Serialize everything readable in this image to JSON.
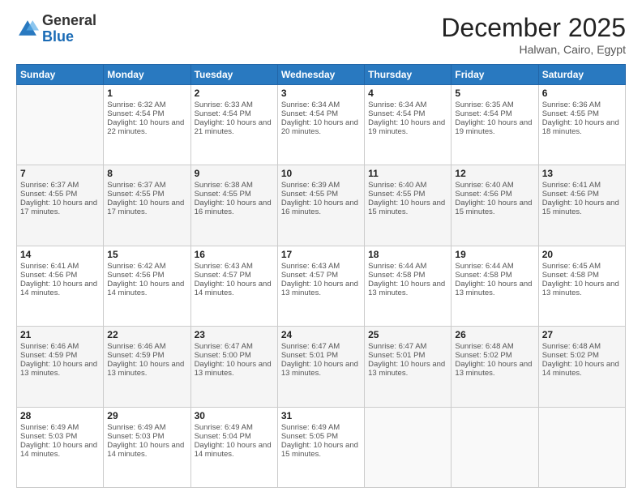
{
  "logo": {
    "general": "General",
    "blue": "Blue"
  },
  "header": {
    "month": "December 2025",
    "location": "Halwan, Cairo, Egypt"
  },
  "days_of_week": [
    "Sunday",
    "Monday",
    "Tuesday",
    "Wednesday",
    "Thursday",
    "Friday",
    "Saturday"
  ],
  "weeks": [
    [
      {
        "day": "",
        "sunrise": "",
        "sunset": "",
        "daylight": ""
      },
      {
        "day": "1",
        "sunrise": "Sunrise: 6:32 AM",
        "sunset": "Sunset: 4:54 PM",
        "daylight": "Daylight: 10 hours and 22 minutes."
      },
      {
        "day": "2",
        "sunrise": "Sunrise: 6:33 AM",
        "sunset": "Sunset: 4:54 PM",
        "daylight": "Daylight: 10 hours and 21 minutes."
      },
      {
        "day": "3",
        "sunrise": "Sunrise: 6:34 AM",
        "sunset": "Sunset: 4:54 PM",
        "daylight": "Daylight: 10 hours and 20 minutes."
      },
      {
        "day": "4",
        "sunrise": "Sunrise: 6:34 AM",
        "sunset": "Sunset: 4:54 PM",
        "daylight": "Daylight: 10 hours and 19 minutes."
      },
      {
        "day": "5",
        "sunrise": "Sunrise: 6:35 AM",
        "sunset": "Sunset: 4:54 PM",
        "daylight": "Daylight: 10 hours and 19 minutes."
      },
      {
        "day": "6",
        "sunrise": "Sunrise: 6:36 AM",
        "sunset": "Sunset: 4:55 PM",
        "daylight": "Daylight: 10 hours and 18 minutes."
      }
    ],
    [
      {
        "day": "7",
        "sunrise": "Sunrise: 6:37 AM",
        "sunset": "Sunset: 4:55 PM",
        "daylight": "Daylight: 10 hours and 17 minutes."
      },
      {
        "day": "8",
        "sunrise": "Sunrise: 6:37 AM",
        "sunset": "Sunset: 4:55 PM",
        "daylight": "Daylight: 10 hours and 17 minutes."
      },
      {
        "day": "9",
        "sunrise": "Sunrise: 6:38 AM",
        "sunset": "Sunset: 4:55 PM",
        "daylight": "Daylight: 10 hours and 16 minutes."
      },
      {
        "day": "10",
        "sunrise": "Sunrise: 6:39 AM",
        "sunset": "Sunset: 4:55 PM",
        "daylight": "Daylight: 10 hours and 16 minutes."
      },
      {
        "day": "11",
        "sunrise": "Sunrise: 6:40 AM",
        "sunset": "Sunset: 4:55 PM",
        "daylight": "Daylight: 10 hours and 15 minutes."
      },
      {
        "day": "12",
        "sunrise": "Sunrise: 6:40 AM",
        "sunset": "Sunset: 4:56 PM",
        "daylight": "Daylight: 10 hours and 15 minutes."
      },
      {
        "day": "13",
        "sunrise": "Sunrise: 6:41 AM",
        "sunset": "Sunset: 4:56 PM",
        "daylight": "Daylight: 10 hours and 15 minutes."
      }
    ],
    [
      {
        "day": "14",
        "sunrise": "Sunrise: 6:41 AM",
        "sunset": "Sunset: 4:56 PM",
        "daylight": "Daylight: 10 hours and 14 minutes."
      },
      {
        "day": "15",
        "sunrise": "Sunrise: 6:42 AM",
        "sunset": "Sunset: 4:56 PM",
        "daylight": "Daylight: 10 hours and 14 minutes."
      },
      {
        "day": "16",
        "sunrise": "Sunrise: 6:43 AM",
        "sunset": "Sunset: 4:57 PM",
        "daylight": "Daylight: 10 hours and 14 minutes."
      },
      {
        "day": "17",
        "sunrise": "Sunrise: 6:43 AM",
        "sunset": "Sunset: 4:57 PM",
        "daylight": "Daylight: 10 hours and 13 minutes."
      },
      {
        "day": "18",
        "sunrise": "Sunrise: 6:44 AM",
        "sunset": "Sunset: 4:58 PM",
        "daylight": "Daylight: 10 hours and 13 minutes."
      },
      {
        "day": "19",
        "sunrise": "Sunrise: 6:44 AM",
        "sunset": "Sunset: 4:58 PM",
        "daylight": "Daylight: 10 hours and 13 minutes."
      },
      {
        "day": "20",
        "sunrise": "Sunrise: 6:45 AM",
        "sunset": "Sunset: 4:58 PM",
        "daylight": "Daylight: 10 hours and 13 minutes."
      }
    ],
    [
      {
        "day": "21",
        "sunrise": "Sunrise: 6:46 AM",
        "sunset": "Sunset: 4:59 PM",
        "daylight": "Daylight: 10 hours and 13 minutes."
      },
      {
        "day": "22",
        "sunrise": "Sunrise: 6:46 AM",
        "sunset": "Sunset: 4:59 PM",
        "daylight": "Daylight: 10 hours and 13 minutes."
      },
      {
        "day": "23",
        "sunrise": "Sunrise: 6:47 AM",
        "sunset": "Sunset: 5:00 PM",
        "daylight": "Daylight: 10 hours and 13 minutes."
      },
      {
        "day": "24",
        "sunrise": "Sunrise: 6:47 AM",
        "sunset": "Sunset: 5:01 PM",
        "daylight": "Daylight: 10 hours and 13 minutes."
      },
      {
        "day": "25",
        "sunrise": "Sunrise: 6:47 AM",
        "sunset": "Sunset: 5:01 PM",
        "daylight": "Daylight: 10 hours and 13 minutes."
      },
      {
        "day": "26",
        "sunrise": "Sunrise: 6:48 AM",
        "sunset": "Sunset: 5:02 PM",
        "daylight": "Daylight: 10 hours and 13 minutes."
      },
      {
        "day": "27",
        "sunrise": "Sunrise: 6:48 AM",
        "sunset": "Sunset: 5:02 PM",
        "daylight": "Daylight: 10 hours and 14 minutes."
      }
    ],
    [
      {
        "day": "28",
        "sunrise": "Sunrise: 6:49 AM",
        "sunset": "Sunset: 5:03 PM",
        "daylight": "Daylight: 10 hours and 14 minutes."
      },
      {
        "day": "29",
        "sunrise": "Sunrise: 6:49 AM",
        "sunset": "Sunset: 5:03 PM",
        "daylight": "Daylight: 10 hours and 14 minutes."
      },
      {
        "day": "30",
        "sunrise": "Sunrise: 6:49 AM",
        "sunset": "Sunset: 5:04 PM",
        "daylight": "Daylight: 10 hours and 14 minutes."
      },
      {
        "day": "31",
        "sunrise": "Sunrise: 6:49 AM",
        "sunset": "Sunset: 5:05 PM",
        "daylight": "Daylight: 10 hours and 15 minutes."
      },
      {
        "day": "",
        "sunrise": "",
        "sunset": "",
        "daylight": ""
      },
      {
        "day": "",
        "sunrise": "",
        "sunset": "",
        "daylight": ""
      },
      {
        "day": "",
        "sunrise": "",
        "sunset": "",
        "daylight": ""
      }
    ]
  ]
}
